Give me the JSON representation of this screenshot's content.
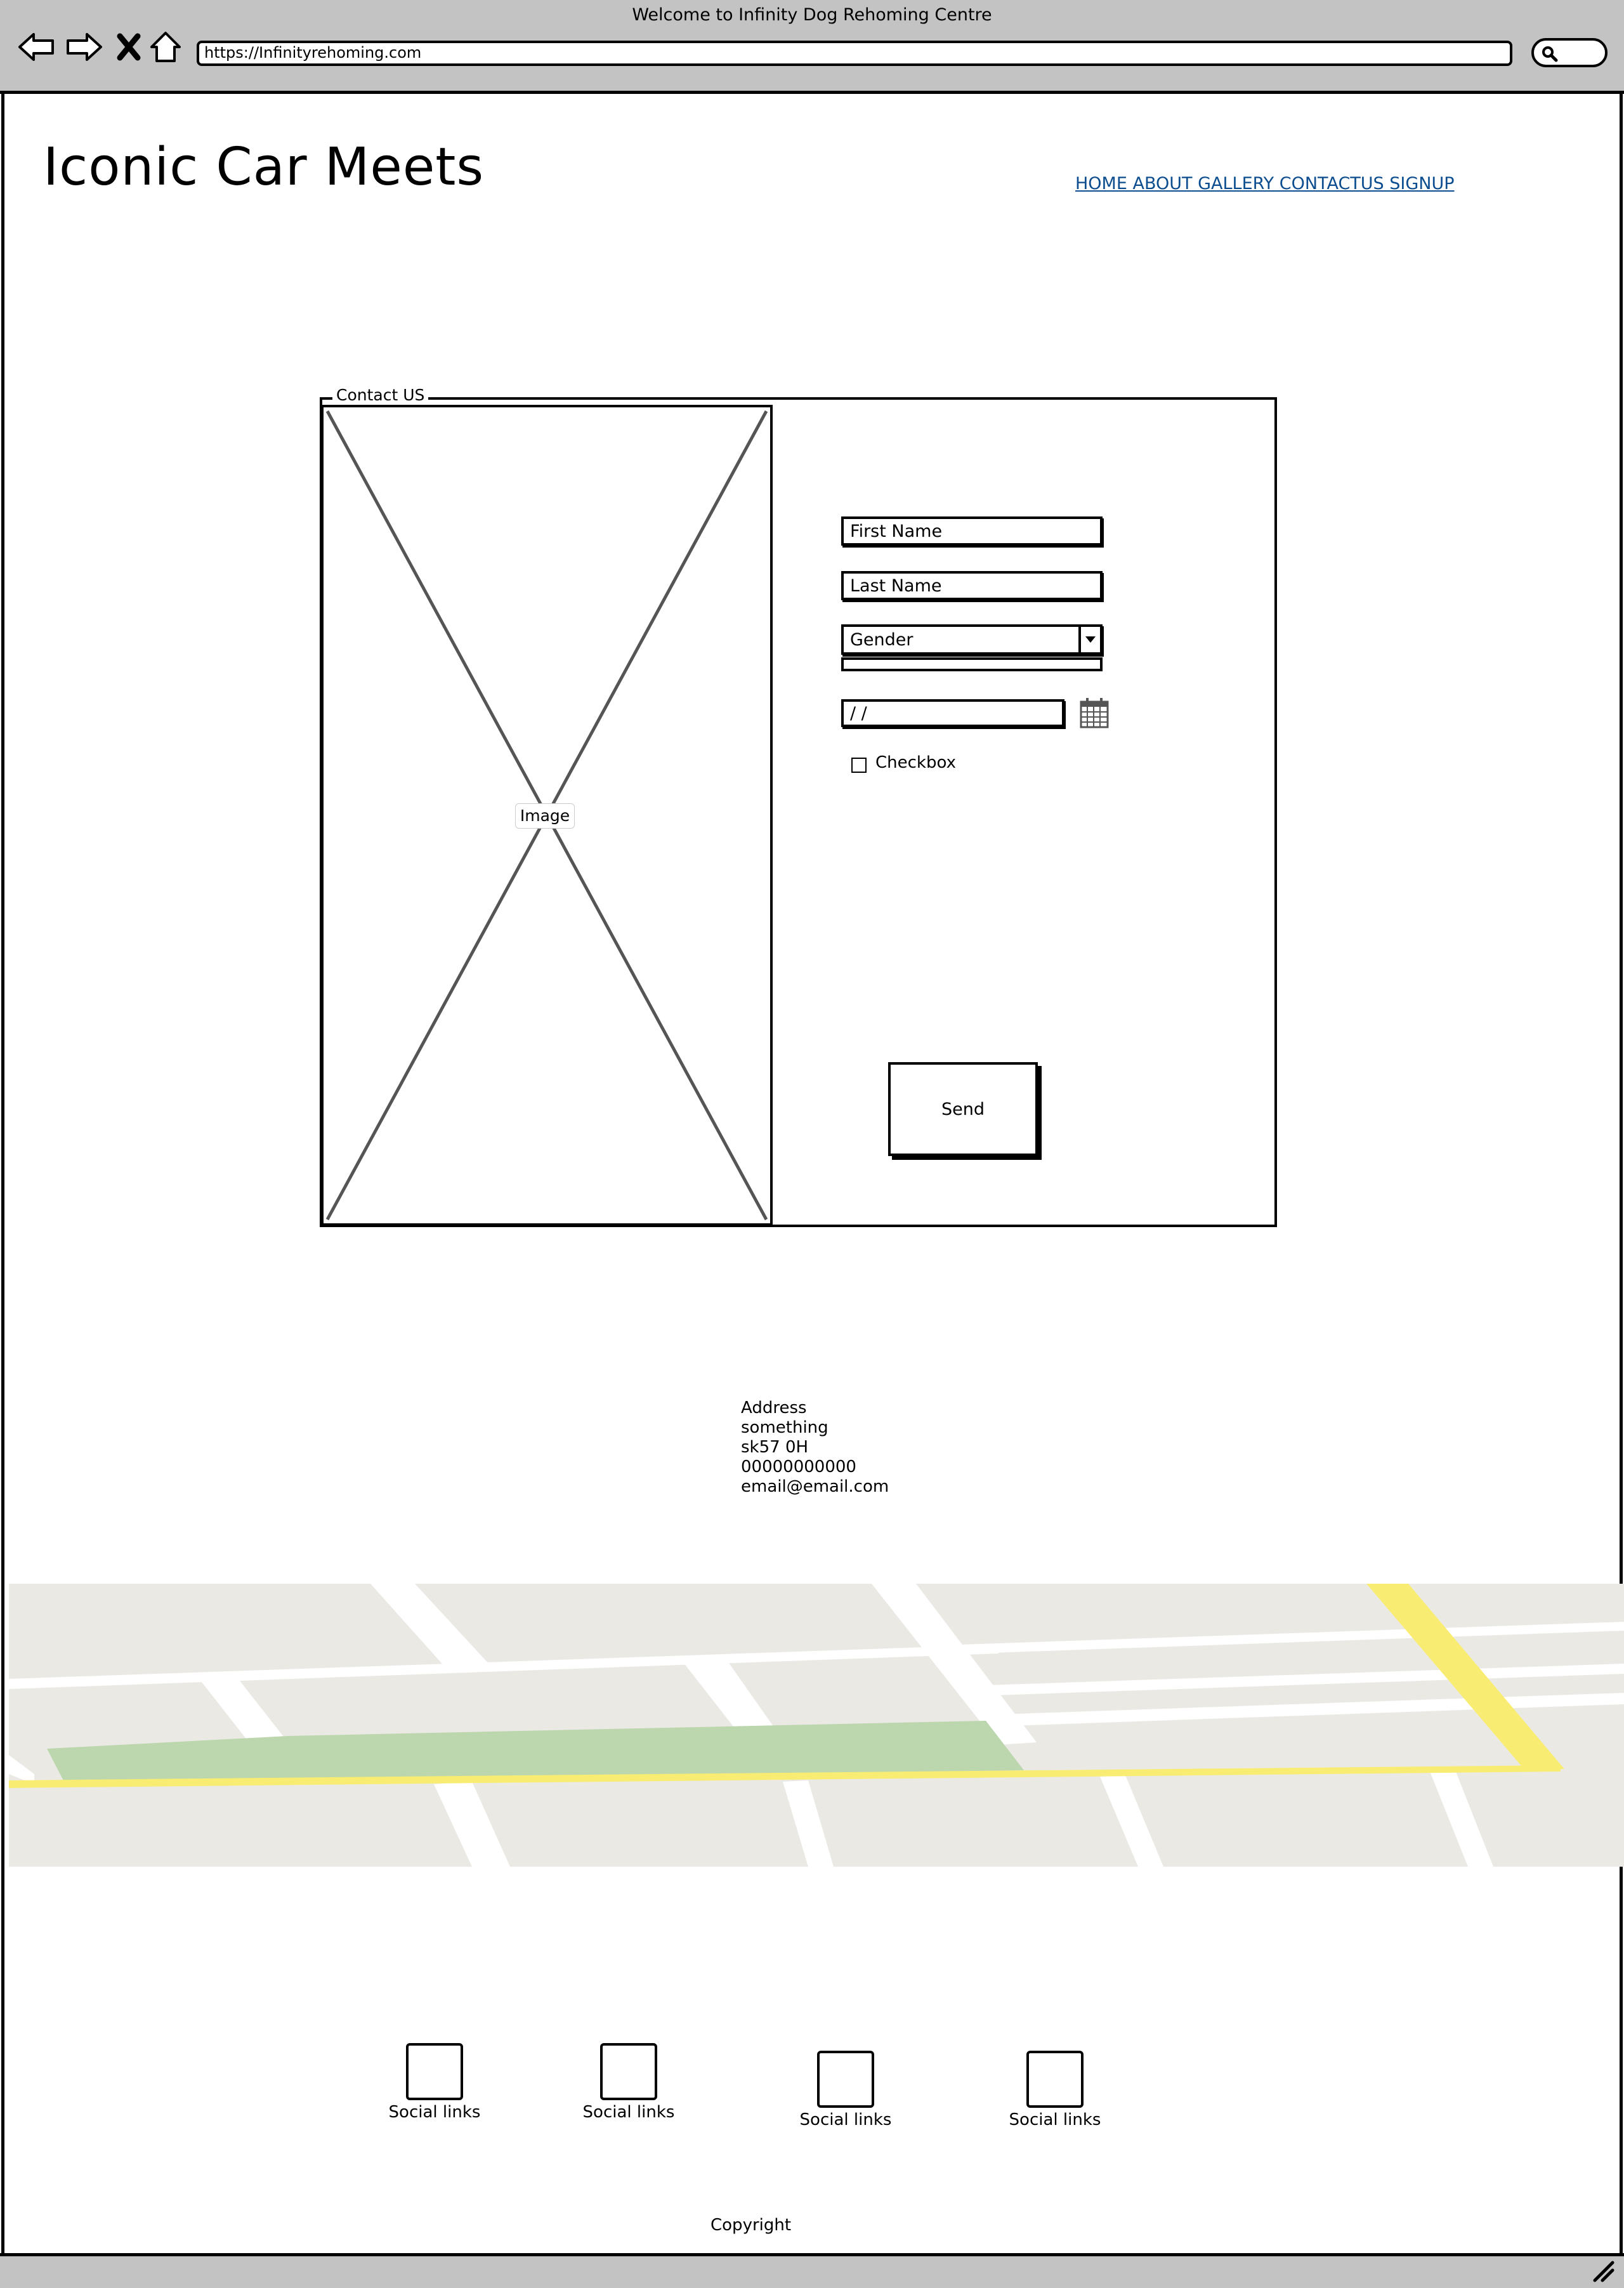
{
  "window": {
    "title": "Welcome to Infinity Dog Rehoming Centre",
    "url": "https://Infinityrehoming.com",
    "icons": [
      "back-arrow-icon",
      "forward-arrow-icon",
      "close-icon",
      "home-icon",
      "search-icon",
      "resize-grip-icon"
    ]
  },
  "header": {
    "site_title": "Iconic Car Meets",
    "nav_links": "HOME ABOUT GALLERY CONTACTUS SIGNUP"
  },
  "contact_form": {
    "legend": "Contact US",
    "image_label": "Image",
    "first_name_placeholder": "First Name",
    "last_name_placeholder": "Last Name",
    "gender_selected": "Gender",
    "date_value": " /  /",
    "checkbox_label": "Checkbox",
    "send_label": "Send"
  },
  "address": {
    "line1": "Address",
    "line2": "something",
    "line3": "sk57 0H",
    "phone": "00000000000",
    "email": "email@email.com"
  },
  "social": [
    {
      "label": "Social links"
    },
    {
      "label": "Social links"
    },
    {
      "label": "Social links"
    },
    {
      "label": "Social links"
    }
  ],
  "footer": {
    "copyright": "Copyright"
  },
  "colors": {
    "chrome": "#c3c3c3",
    "link": "#0b4d8e",
    "map_block": "#ebe9e4",
    "map_park": "#bcd6ae",
    "map_highway": "#f8ed72"
  }
}
